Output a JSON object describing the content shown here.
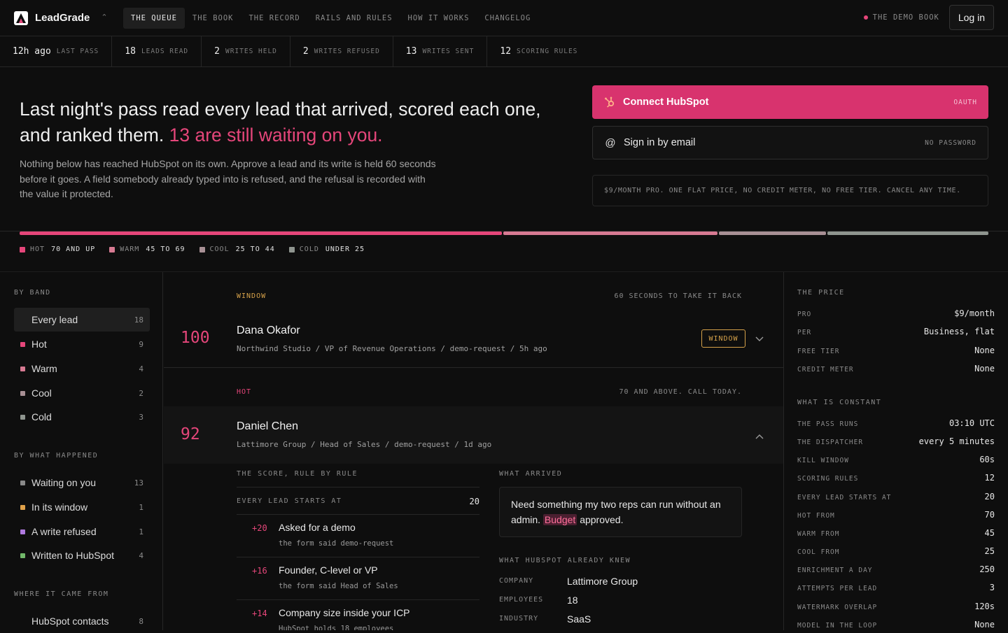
{
  "brand": {
    "name": "LeadGrade"
  },
  "nav": {
    "links": [
      "THE QUEUE",
      "THE BOOK",
      "THE RECORD",
      "RAILS AND RULES",
      "HOW IT WORKS",
      "CHANGELOG"
    ],
    "demo_book": "THE DEMO BOOK",
    "login": "Log in"
  },
  "stats": [
    {
      "num": "12h ago",
      "label": "LAST PASS"
    },
    {
      "num": "18",
      "label": "LEADS READ"
    },
    {
      "num": "2",
      "label": "WRITES HELD"
    },
    {
      "num": "2",
      "label": "WRITES REFUSED"
    },
    {
      "num": "13",
      "label": "WRITES SENT"
    },
    {
      "num": "12",
      "label": "SCORING RULES"
    }
  ],
  "hero": {
    "headline": "Last night's pass read every lead that arrived, scored each one, and ranked them.",
    "headline_highlight": "13 are still waiting on you.",
    "body": "Nothing below has reached HubSpot on its own. Approve a lead and its write is held 60 seconds before it goes. A field somebody already typed into is refused, and the refusal is recorded with the value it protected."
  },
  "cta": {
    "hubspot": {
      "label": "Connect HubSpot",
      "tag": "OAUTH"
    },
    "email": {
      "label": "Sign in by email",
      "tag": "NO PASSWORD"
    },
    "price_note": "$9/MONTH PRO. ONE FLAT PRICE, NO CREDIT METER, NO FREE TIER. CANCEL ANY TIME."
  },
  "bands": {
    "colors": {
      "hot": "#e5467a",
      "warm": "#d77a92",
      "cool": "#a89095",
      "cold": "#8f958f"
    },
    "shares": [
      0.5,
      0.222,
      0.111,
      0.167
    ],
    "legend": [
      {
        "name": "HOT",
        "range": "70 AND UP"
      },
      {
        "name": "WARM",
        "range": "45 TO 69"
      },
      {
        "name": "COOL",
        "range": "25 TO 44"
      },
      {
        "name": "COLD",
        "range": "UNDER 25"
      }
    ]
  },
  "sidebar": {
    "by_band_title": "BY BAND",
    "by_band": [
      {
        "label": "Every lead",
        "count": "18"
      },
      {
        "label": "Hot",
        "count": "9"
      },
      {
        "label": "Warm",
        "count": "4"
      },
      {
        "label": "Cool",
        "count": "2"
      },
      {
        "label": "Cold",
        "count": "3"
      }
    ],
    "by_happened_title": "BY WHAT HAPPENED",
    "by_happened": [
      {
        "label": "Waiting on you",
        "count": "13"
      },
      {
        "label": "In its window",
        "count": "1"
      },
      {
        "label": "A write refused",
        "count": "1"
      },
      {
        "label": "Written to HubSpot",
        "count": "4"
      }
    ],
    "source_title": "WHERE IT CAME FROM",
    "sources": [
      {
        "label": "HubSpot contacts",
        "count": "8"
      }
    ]
  },
  "queue": {
    "window_group": {
      "label": "WINDOW",
      "note": "60 SECONDS TO TAKE IT BACK"
    },
    "lead1": {
      "score": "100",
      "name": "Dana Okafor",
      "meta": "Northwind Studio / VP of Revenue Operations / demo-request / 5h ago",
      "badge": "WINDOW"
    },
    "hot_group": {
      "label": "HOT",
      "note": "70 AND ABOVE. CALL TODAY."
    },
    "lead2": {
      "score": "92",
      "name": "Daniel Chen",
      "meta": "Lattimore Group / Head of Sales / demo-request / 1d ago"
    },
    "score_title": "THE SCORE, RULE BY RULE",
    "base": {
      "label": "EVERY LEAD STARTS AT",
      "value": "20"
    },
    "rules": [
      {
        "delta": "+20",
        "title": "Asked for a demo",
        "sub": "the form said demo-request"
      },
      {
        "delta": "+16",
        "title": "Founder, C-level or VP",
        "sub": "the form said Head of Sales"
      },
      {
        "delta": "+14",
        "title": "Company size inside your ICP",
        "sub": "HubSpot holds 18 employees"
      }
    ],
    "arrived_title": "WHAT ARRIVED",
    "arrived_before": "Need something my two reps can run without an admin.",
    "arrived_highlight": "Budget",
    "arrived_after": "approved.",
    "knew_title": "WHAT HUBSPOT ALREADY KNEW",
    "knew": [
      {
        "k": "COMPANY",
        "v": "Lattimore Group"
      },
      {
        "k": "EMPLOYEES",
        "v": "18"
      },
      {
        "k": "INDUSTRY",
        "v": "SaaS"
      }
    ]
  },
  "right": {
    "price_title": "THE PRICE",
    "price": [
      {
        "k": "PRO",
        "v": "$9/month"
      },
      {
        "k": "PER",
        "v": "Business, flat"
      },
      {
        "k": "FREE TIER",
        "v": "None"
      },
      {
        "k": "CREDIT METER",
        "v": "None"
      }
    ],
    "constant_title": "WHAT IS CONSTANT",
    "constant": [
      {
        "k": "THE PASS RUNS",
        "v": "03:10 UTC"
      },
      {
        "k": "THE DISPATCHER",
        "v": "every 5 minutes"
      },
      {
        "k": "KILL WINDOW",
        "v": "60s"
      },
      {
        "k": "SCORING RULES",
        "v": "12"
      },
      {
        "k": "EVERY LEAD STARTS AT",
        "v": "20"
      },
      {
        "k": "HOT FROM",
        "v": "70"
      },
      {
        "k": "WARM FROM",
        "v": "45"
      },
      {
        "k": "COOL FROM",
        "v": "25"
      },
      {
        "k": "ENRICHMENT A DAY",
        "v": "250"
      },
      {
        "k": "ATTEMPTS PER LEAD",
        "v": "3"
      },
      {
        "k": "WATERMARK OVERLAP",
        "v": "120s"
      },
      {
        "k": "MODEL IN THE LOOP",
        "v": "None"
      }
    ]
  }
}
